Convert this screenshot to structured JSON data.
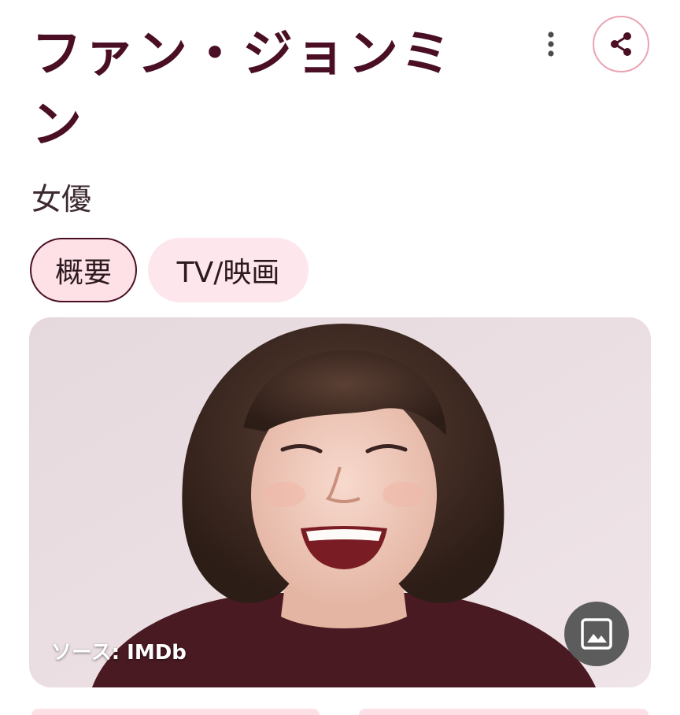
{
  "header": {
    "title": "ファン・ジョンミン",
    "subtitle": "女優"
  },
  "actions": {
    "more_icon": "more-vert-icon",
    "share_icon": "share-icon"
  },
  "tabs": [
    {
      "label": "概要",
      "selected": true
    },
    {
      "label": "TV/映画",
      "selected": false
    }
  ],
  "photo": {
    "source": "ソース: IMDb",
    "button_icon": "image-icon"
  },
  "colors": {
    "title": "#4a0f24",
    "chip_bg": "#fde1e6",
    "share_border": "#eba3b3",
    "photo_bg": "#e9dde1"
  }
}
